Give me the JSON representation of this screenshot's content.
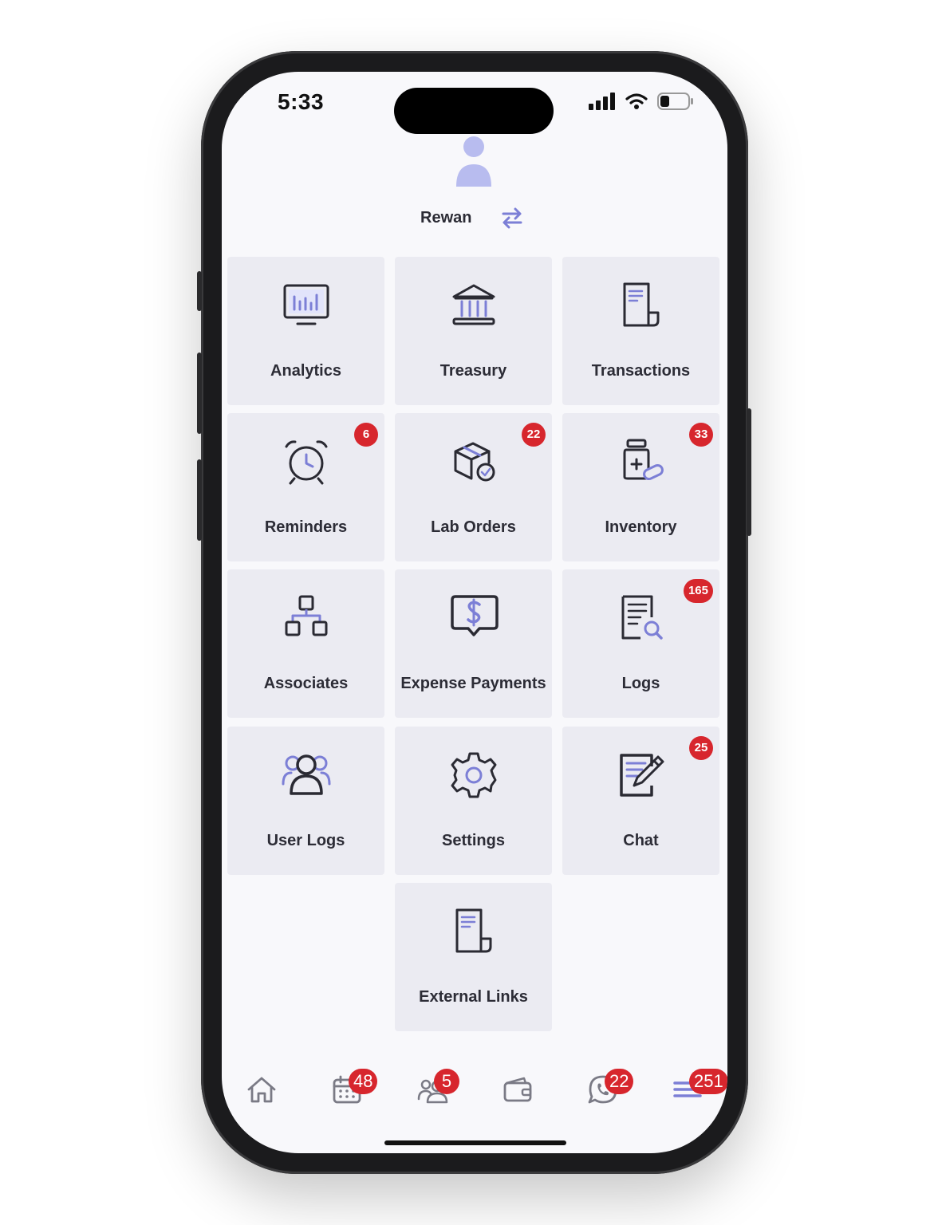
{
  "status": {
    "time": "5:33"
  },
  "user": {
    "name": "Rewan"
  },
  "tiles": [
    {
      "label": "Analytics",
      "icon": "analytics-monitor-icon",
      "badge": ""
    },
    {
      "label": "Treasury",
      "icon": "bank-icon",
      "badge": ""
    },
    {
      "label": "Transactions",
      "icon": "document-icon",
      "badge": ""
    },
    {
      "label": "Reminders",
      "icon": "alarm-clock-icon",
      "badge": "6"
    },
    {
      "label": "Lab Orders",
      "icon": "package-check-icon",
      "badge": "22"
    },
    {
      "label": "Inventory",
      "icon": "medicine-bottle-icon",
      "badge": "33"
    },
    {
      "label": "Associates",
      "icon": "hierarchy-icon",
      "badge": ""
    },
    {
      "label": "Expense Payments",
      "icon": "payment-chat-icon",
      "badge": ""
    },
    {
      "label": "Logs",
      "icon": "log-search-icon",
      "badge": "165"
    },
    {
      "label": "User Logs",
      "icon": "users-icon",
      "badge": ""
    },
    {
      "label": "Settings",
      "icon": "gear-icon",
      "badge": ""
    },
    {
      "label": "Chat",
      "icon": "edit-note-icon",
      "badge": "25"
    },
    {
      "label": "External Links",
      "icon": "document-icon",
      "badge": ""
    }
  ],
  "tabbar": [
    {
      "icon": "home-icon",
      "badge": ""
    },
    {
      "icon": "calendar-icon",
      "badge": "48"
    },
    {
      "icon": "people-icon",
      "badge": "5"
    },
    {
      "icon": "wallet-icon",
      "badge": ""
    },
    {
      "icon": "whatsapp-icon",
      "badge": "22"
    },
    {
      "icon": "menu-icon",
      "badge": "251"
    }
  ],
  "colors": {
    "accent": "#7c7fd6",
    "badge": "#d7262d",
    "tile": "#ebebf2"
  }
}
